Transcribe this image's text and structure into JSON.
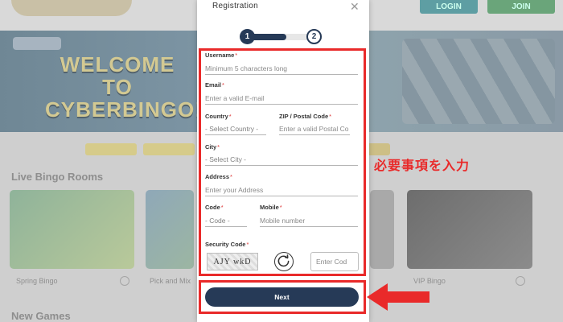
{
  "background": {
    "login_label": "LOGIN",
    "join_label": "JOIN",
    "banner_text": "WELCOME TO CYBERBINGO!",
    "live_rooms_title": "Live Bingo Rooms",
    "rooms": [
      "Spring Bingo",
      "Pick and Mix",
      "VIP Bingo"
    ],
    "new_games_title": "New Games"
  },
  "modal": {
    "title": "Registration",
    "steps": [
      "1",
      "2"
    ],
    "fields": {
      "username": {
        "label": "Username",
        "placeholder": "Minimum 5 characters long"
      },
      "email": {
        "label": "Email",
        "placeholder": "Enter a valid E-mail"
      },
      "country": {
        "label": "Country",
        "value": "- Select Country -"
      },
      "zip": {
        "label": "ZIP / Postal Code",
        "placeholder": "Enter a valid Postal Co"
      },
      "city": {
        "label": "City",
        "value": "- Select City -"
      },
      "address": {
        "label": "Address",
        "placeholder": "Enter your Address"
      },
      "code": {
        "label": "Code",
        "value": "- Code -"
      },
      "mobile": {
        "label": "Mobile",
        "placeholder": "Mobile number"
      },
      "security": {
        "label": "Security Code",
        "captcha": "AJY wkD",
        "placeholder": "Enter Cod"
      }
    },
    "required_mark": "*",
    "next_label": "Next"
  },
  "annotation": {
    "note": "必要事項を入力",
    "color": "#e92a2a"
  }
}
